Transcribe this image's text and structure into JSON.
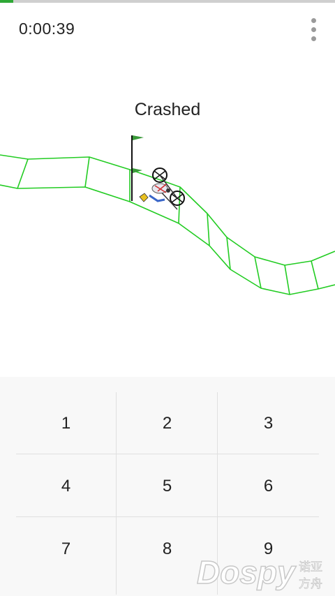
{
  "game": {
    "timer": "0:00:39",
    "status": "Crashed",
    "progress": 0.04,
    "track_color": "#22cc22",
    "accent": "#2ea836"
  },
  "toolbar": {
    "menu_icon": "more-vert-icon"
  },
  "keypad": {
    "keys": [
      "1",
      "2",
      "3",
      "4",
      "5",
      "6",
      "7",
      "8",
      "9"
    ]
  },
  "watermark": {
    "brand": "Dospy",
    "cjk": "诺亚方舟"
  }
}
